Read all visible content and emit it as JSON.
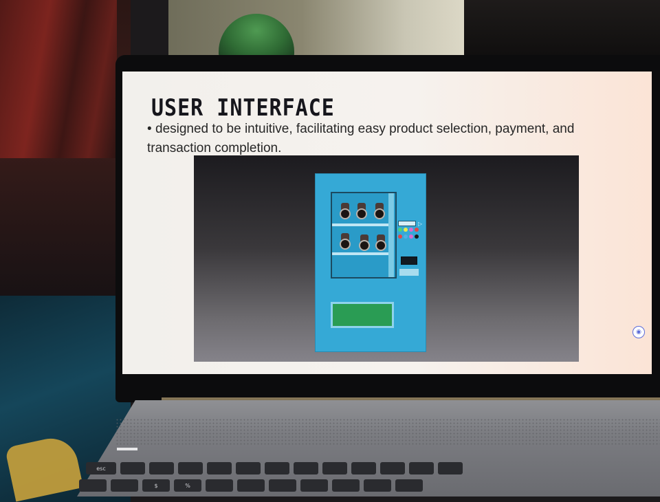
{
  "slide": {
    "title": "USER INTERFACE",
    "bullet": "designed to be intuitive, facilitating easy product selection, payment, and transaction completion."
  },
  "colors": {
    "machine_body": "#35a9d6",
    "tray": "#2a9c54",
    "slide_background": "#f4f1ed",
    "title_text": "#16161c"
  },
  "icons": {
    "presenter": "presenter-icon"
  },
  "keyboard": {
    "row1": [
      "esc",
      "",
      "",
      "",
      "",
      "",
      "",
      "",
      "",
      "",
      "",
      "",
      ""
    ],
    "row2": [
      "",
      "",
      "$",
      "%",
      "",
      "",
      "",
      "",
      "",
      "",
      ""
    ]
  }
}
